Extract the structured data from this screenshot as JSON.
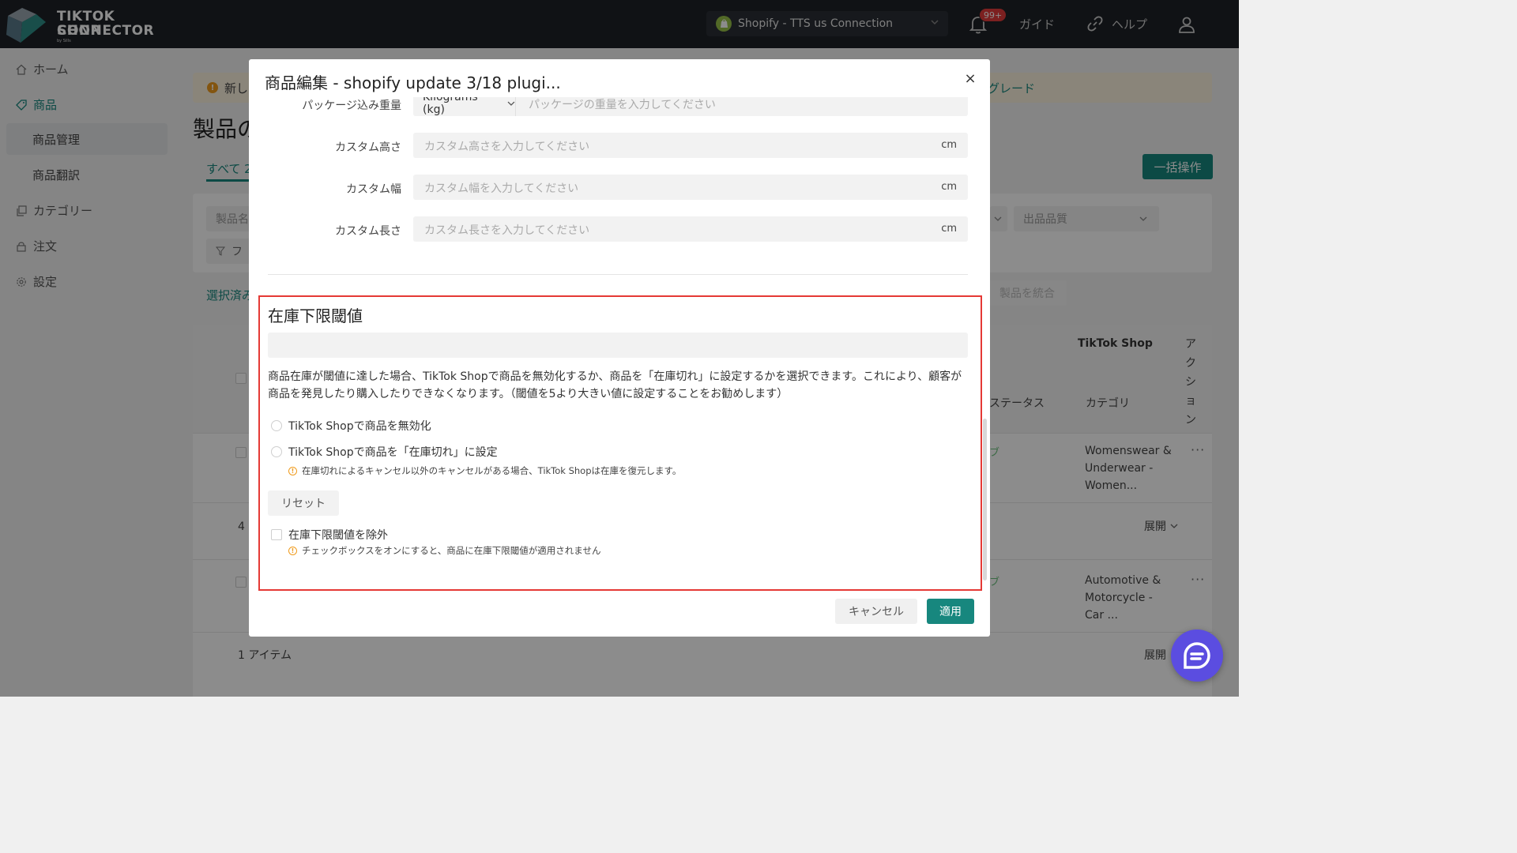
{
  "header": {
    "logo_line1": "TIKTOK SHOP",
    "logo_line2": "CONNECTOR",
    "logo_by": "by Sills",
    "shop_selector": "Shopify - TTS us Connection",
    "notification_badge": "99+",
    "guide_label": "ガイド",
    "help_label": "ヘルプ"
  },
  "sidebar": {
    "home": "ホーム",
    "products": "商品",
    "product_management": "商品管理",
    "product_translation": "商品翻訳",
    "category": "カテゴリー",
    "orders": "注文",
    "settings": "設定"
  },
  "background_page": {
    "notice_text": "新し",
    "notice_link": "グレード",
    "title": "製品の",
    "tab_all": "すべて 2",
    "bulk_button": "一括操作",
    "filter_name": "製品名",
    "filter_button": "フ",
    "filter_quality": "出品品質",
    "selected_label": "選択済み",
    "merge_button": "製品を統合",
    "col_tiktok_shop": "TikTok Shop",
    "col_action": "アクション",
    "col_status": "ステータス",
    "col_category": "カテゴリ",
    "row1_category": "Womenswear & Underwear - Women...",
    "row2_category": "Automotive & Motorcycle - Car ...",
    "row_status_tag": "ブ",
    "expand_label": "展開",
    "count_4": "4",
    "items_count": "1 アイテム",
    "row_more": "···"
  },
  "modal": {
    "title": "商品編集 - shopify update 3/18 plugi...",
    "close": "×",
    "package_weight_label": "パッケージ込み重量",
    "weight_unit": "Kilograms (kg)",
    "weight_placeholder": "パッケージの重量を入力してください",
    "custom_height_label": "カスタム高さ",
    "custom_height_placeholder": "カスタム高さを入力してください",
    "custom_width_label": "カスタム幅",
    "custom_width_placeholder": "カスタム幅を入力してください",
    "custom_length_label": "カスタム長さ",
    "custom_length_placeholder": "カスタム長さを入力してください",
    "unit_cm": "cm",
    "section_title": "在庫下限閾値",
    "description": "商品在庫が閾値に達した場合、TikTok Shopで商品を無効化するか、商品を「在庫切れ」に設定するかを選択できます。これにより、顧客が商品を発見したり購入したりできなくなります。（閾値を5より大きい値に設定することをお勧めします）",
    "option_disable": "TikTok Shopで商品を無効化",
    "option_out_of_stock": "TikTok Shopで商品を「在庫切れ」に設定",
    "hint_restore": "在庫切れによるキャンセル以外のキャンセルがある場合、TikTok Shopは在庫を復元します。",
    "reset_button": "リセット",
    "exclude_checkbox": "在庫下限閾値を除外",
    "hint_exclude": "チェックボックスをオンにすると、商品に在庫下限閾値が適用されません",
    "cancel_button": "キャンセル",
    "apply_button": "適用"
  },
  "colors": {
    "accent": "#17877e",
    "topbar": "#1e2227",
    "highlight_border": "#e53935",
    "warning": "#ef9b1e",
    "chat_fab": "#5b4de0"
  }
}
